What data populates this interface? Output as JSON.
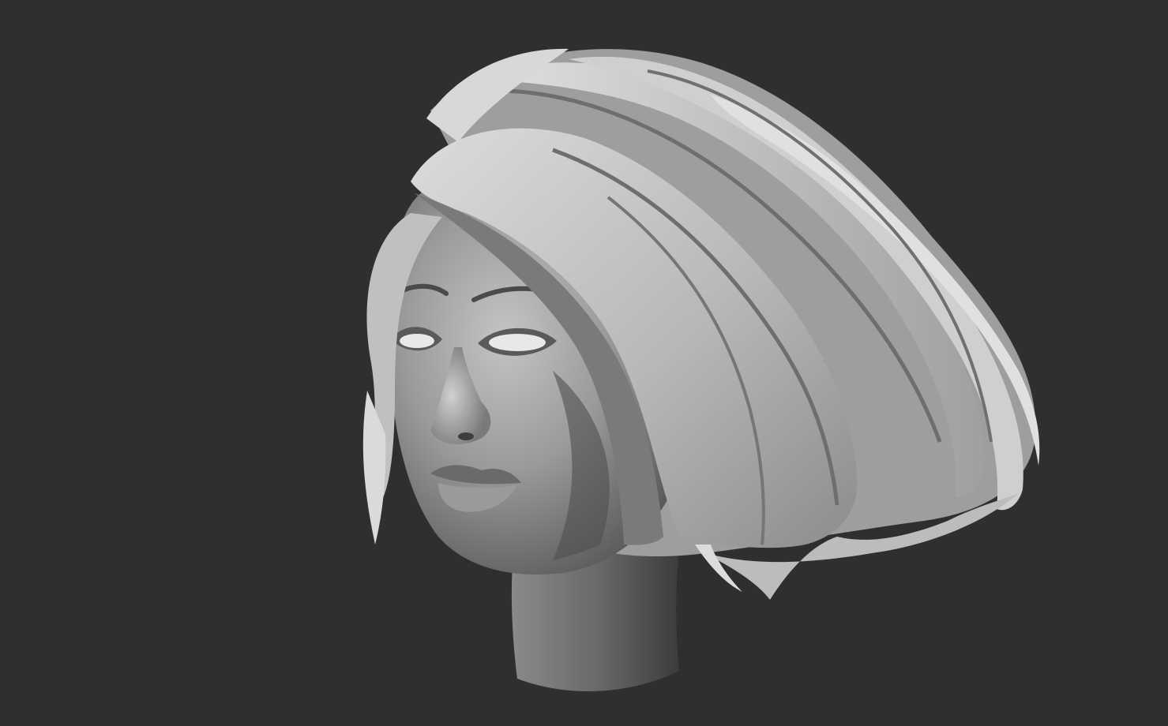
{
  "scene": {
    "subject": "sculpted-head-bob-haircut",
    "render_style": "clay-matcap",
    "colors": {
      "background": "#2f2f2f",
      "clay_light": "#d4d4d4",
      "clay_mid": "#a8a8a8",
      "clay_dark": "#5e5e5e",
      "clay_shadow": "#3e3e3e",
      "eye_white": "#e8e8e8"
    }
  }
}
